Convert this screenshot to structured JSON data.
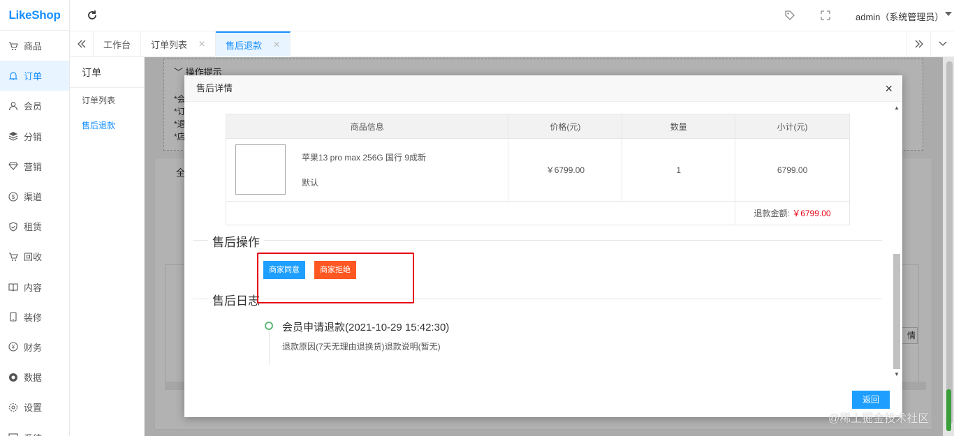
{
  "brand": {
    "logo": "LikeShop"
  },
  "sidebar": {
    "items": [
      {
        "label": "商品",
        "icon": "cart-icon"
      },
      {
        "label": "订单",
        "icon": "bell-icon",
        "active": true
      },
      {
        "label": "会员",
        "icon": "user-icon"
      },
      {
        "label": "分销",
        "icon": "layers-icon"
      },
      {
        "label": "营销",
        "icon": "diamond-icon"
      },
      {
        "label": "渠道",
        "icon": "dollar-circle-icon"
      },
      {
        "label": "租赁",
        "icon": "shield-icon"
      },
      {
        "label": "回收",
        "icon": "cart-icon"
      },
      {
        "label": "内容",
        "icon": "book-icon"
      },
      {
        "label": "装修",
        "icon": "tablet-icon"
      },
      {
        "label": "财务",
        "icon": "yen-circle-icon"
      },
      {
        "label": "数据",
        "icon": "globe-icon"
      },
      {
        "label": "设置",
        "icon": "gear-icon"
      },
      {
        "label": "系统",
        "icon": "monitor-icon"
      }
    ]
  },
  "header": {
    "user": "admin（系统管理员）"
  },
  "tabs": [
    {
      "label": "工作台",
      "closable": false
    },
    {
      "label": "订单列表",
      "closable": true
    },
    {
      "label": "售后退款",
      "closable": true,
      "active": true
    }
  ],
  "submenu": {
    "title": "订单",
    "items": [
      {
        "label": "订单列表"
      },
      {
        "label": "售后退款",
        "active": true
      }
    ]
  },
  "background": {
    "tips_title": "操作提示",
    "tips_lines": [
      "*会",
      "*订",
      "*退",
      "*店"
    ],
    "card_tab": "全",
    "detail_button": "情"
  },
  "modal": {
    "title": "售后详情",
    "close": "×",
    "table": {
      "headers": [
        "商品信息",
        "价格(元)",
        "数量",
        "小计(元)"
      ],
      "product": {
        "name": "苹果13 pro max 256G 国行 9成新",
        "spec": "默认",
        "price": "￥6799.00",
        "quantity": "1",
        "subtotal": "6799.00"
      },
      "refund_label": "退款金额:",
      "refund_value": "￥6799.00"
    },
    "operations_title": "售后操作",
    "agree_button": "商家同意",
    "reject_button": "商家拒绝",
    "log_title": "售后日志",
    "log": {
      "title": "会员申请退款(2021-10-29 15:42:30)",
      "desc": "退款原因(7天无理由退换货)退款说明(暂无)"
    },
    "back_button": "返回"
  },
  "watermark": "@稀土掘金技术社区",
  "colors": {
    "primary": "#1890ff",
    "agree": "#1e9fff",
    "reject": "#ff5722",
    "highlight_box": "#e60012",
    "refund_value": "#e60012"
  }
}
